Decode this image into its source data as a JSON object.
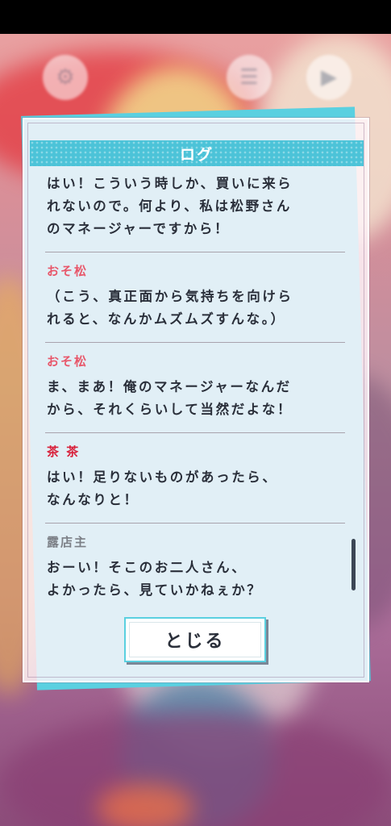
{
  "log_panel": {
    "title": "ログ",
    "entries": [
      {
        "speaker": "",
        "lines": [
          "はい！こういう時しか、買いに来ら",
          "れないので。何より、私は松野さん",
          "のマネージャーですから！"
        ]
      },
      {
        "speaker": "おそ松",
        "speaker_color": "#e8576a",
        "lines": [
          "（こう、真正面から気持ちを向けら",
          "れると、なんかムズムズすんな。）"
        ]
      },
      {
        "speaker": "おそ松",
        "speaker_color": "#e8576a",
        "lines": [
          "ま、まあ！俺のマネージャーなんだ",
          "から、それくらいして当然だよな！"
        ]
      },
      {
        "speaker": "茶 茶",
        "speaker_color": "#d8203a",
        "lines": [
          "はい！足りないものがあったら、",
          "なんなりと！"
        ]
      },
      {
        "speaker": "露店主",
        "speaker_color": "#7b7f86",
        "lines": [
          "おーい！そこのお二人さん、",
          "よかったら、見ていかねぇか？"
        ]
      }
    ],
    "close_button": "とじる"
  },
  "top_controls": {
    "icons": [
      "settings-icon",
      "menu-icon",
      "play-icon"
    ]
  },
  "colors": {
    "accent": "#4cc3d8",
    "text": "#2a2f3a"
  }
}
